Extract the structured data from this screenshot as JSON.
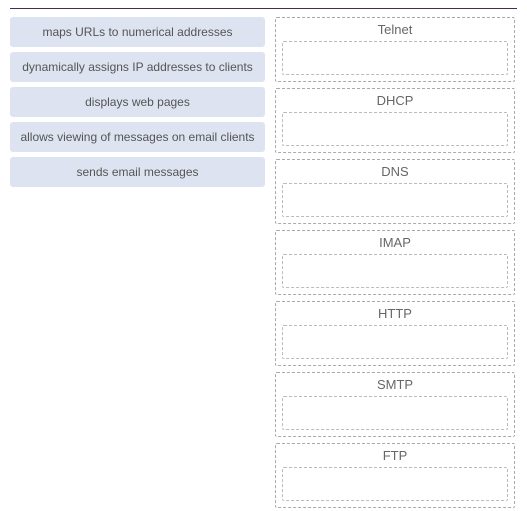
{
  "sources": [
    {
      "label": "maps URLs to numerical addresses"
    },
    {
      "label": "dynamically assigns IP addresses to clients"
    },
    {
      "label": "displays web pages"
    },
    {
      "label": "allows viewing of messages on email clients"
    },
    {
      "label": "sends email messages"
    }
  ],
  "targets": [
    {
      "label": "Telnet"
    },
    {
      "label": "DHCP"
    },
    {
      "label": "DNS"
    },
    {
      "label": "IMAP"
    },
    {
      "label": "HTTP"
    },
    {
      "label": "SMTP"
    },
    {
      "label": "FTP"
    }
  ]
}
